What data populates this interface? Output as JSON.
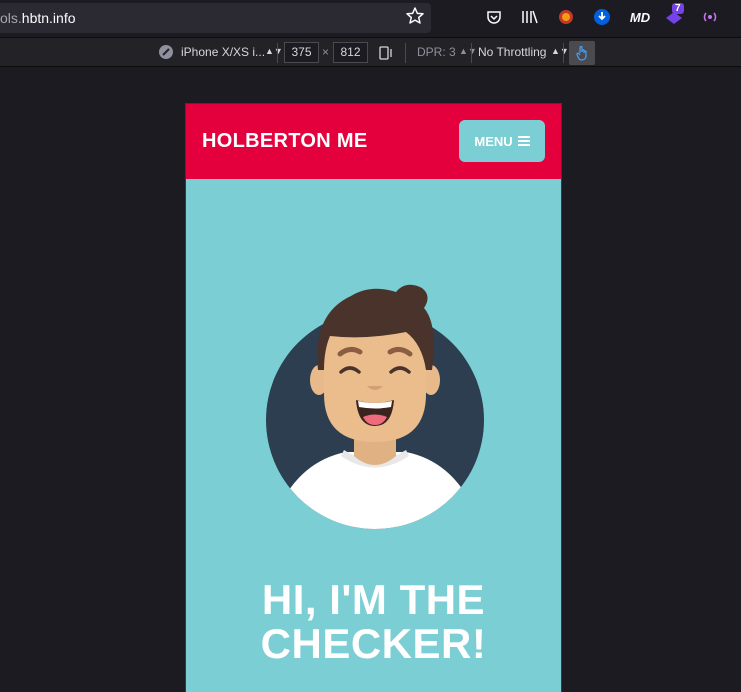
{
  "browser": {
    "url_prefix": "ols.",
    "url_domain": "hbtn.info",
    "badge_count": "7"
  },
  "rdm": {
    "device": "iPhone X/XS i...",
    "width": "375",
    "times": "×",
    "height": "812",
    "dpr": "DPR: 3",
    "throttling": "No Throttling"
  },
  "site": {
    "logo": "HOLBERTON ME",
    "menu_label": "MENU",
    "hero_line1": "HI, I'M THE",
    "hero_line2": "CHECKER!"
  },
  "colors": {
    "header": "#e3003c",
    "background": "#7bced3",
    "avatar_circle": "#2d3e50"
  },
  "icons": [
    "star-icon",
    "pocket-icon",
    "library-icon",
    "extension-icon",
    "download-icon",
    "md-icon",
    "addon-icon",
    "radio-icon",
    "compass-icon",
    "rotate-icon",
    "touch-icon",
    "hamburger-icon"
  ]
}
